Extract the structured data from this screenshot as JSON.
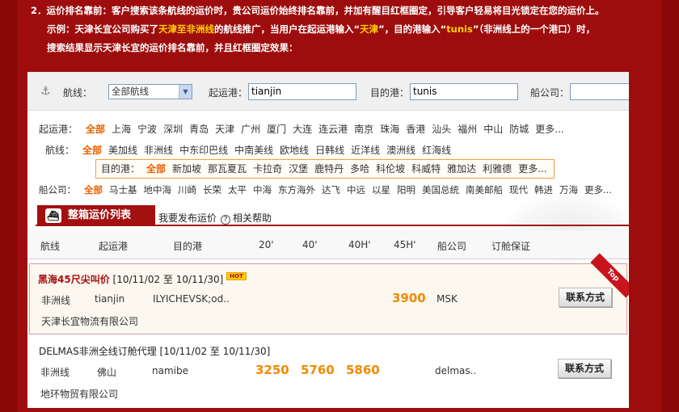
{
  "intro": {
    "line1": "2．运价排名靠前：客户搜索该条航线的运价时，贵公司运价始终排名靠前，并加有醒目红框圈定，引导客户轻易将目光锁定在您的运价上。",
    "line2_a": "示例：天津长宜公司购买了",
    "line2_hl1": "天津至非洲线",
    "line2_b": "的航线推广，当用户在起运港输入“",
    "line2_hl2": "天津",
    "line2_c": "”，目的港输入“",
    "line2_hl3": "tunis",
    "line2_d": "”（非洲线上的一个港口）时，",
    "line3": "搜索结果显示天津长宜的运价排名靠前，并且红框圈定效果："
  },
  "search": {
    "route_label": "航线：",
    "route_value": "全部航线",
    "origin_label": "起运港：",
    "origin_value": "tianjin",
    "dest_label": "目的港：",
    "dest_value": "tunis",
    "carrier_label": "船公司："
  },
  "filters": {
    "origin": {
      "key": "起运港：",
      "items": [
        "全部",
        "上海",
        "宁波",
        "深圳",
        "青岛",
        "天津",
        "广州",
        "厦门",
        "大连",
        "连云港",
        "南京",
        "珠海",
        "香港",
        "汕头",
        "福州",
        "中山",
        "防城",
        "更多..."
      ]
    },
    "route": {
      "key": "航线：",
      "items": [
        "全部",
        "美加线",
        "非洲线",
        "中东印巴线",
        "中南美线",
        "欧地线",
        "日韩线",
        "近洋线",
        "澳洲线",
        "红海线"
      ]
    },
    "dest": {
      "key": "目的港：",
      "items": [
        "全部",
        "新加坡",
        "那瓦夏瓦",
        "卡拉奇",
        "汉堡",
        "鹿特丹",
        "多哈",
        "科伦坡",
        "科威特",
        "雅加达",
        "利雅德",
        "更多..."
      ]
    },
    "carrier": {
      "key": "船公司：",
      "items": [
        "全部",
        "马士基",
        "地中海",
        "川崎",
        "长荣",
        "太平",
        "中海",
        "东方海外",
        "达飞",
        "中远",
        "以星",
        "阳明",
        "美国总统",
        "南美邮船",
        "现代",
        "韩进",
        "万海",
        "更多..."
      ]
    }
  },
  "tabs": {
    "active": "整箱运价列表",
    "publish": "我要发布运价",
    "help": "相关帮助"
  },
  "table_headers": [
    "航线",
    "起运港",
    "目的港",
    "20'",
    "40'",
    "40H'",
    "45H'",
    "船公司",
    "订舱保证"
  ],
  "rows": [
    {
      "title": "黑海45尺尖叫价",
      "dates": "[10/11/02 至 10/11/30]",
      "badge": "HOT",
      "ribbon": "Top",
      "route": "非洲线",
      "origin": "tianjin",
      "dest": "ILYICHEVSK;od..",
      "p20": "",
      "p40": "",
      "p40h": "",
      "p45h": "3900",
      "carrier": "MSK",
      "company": "天津长宜物流有限公司",
      "button": "联系方式"
    },
    {
      "title": "DELMAS非洲全线订舱代理",
      "dates": "[10/11/02 至 10/11/30]",
      "route": "非洲线",
      "origin": "佛山",
      "dest": "namibe",
      "p20": "3250",
      "p40": "5760",
      "p40h": "5860",
      "p45h": "",
      "carrier": "delmas..",
      "company": "地环物贸有限公司",
      "button": "联系方式"
    }
  ]
}
